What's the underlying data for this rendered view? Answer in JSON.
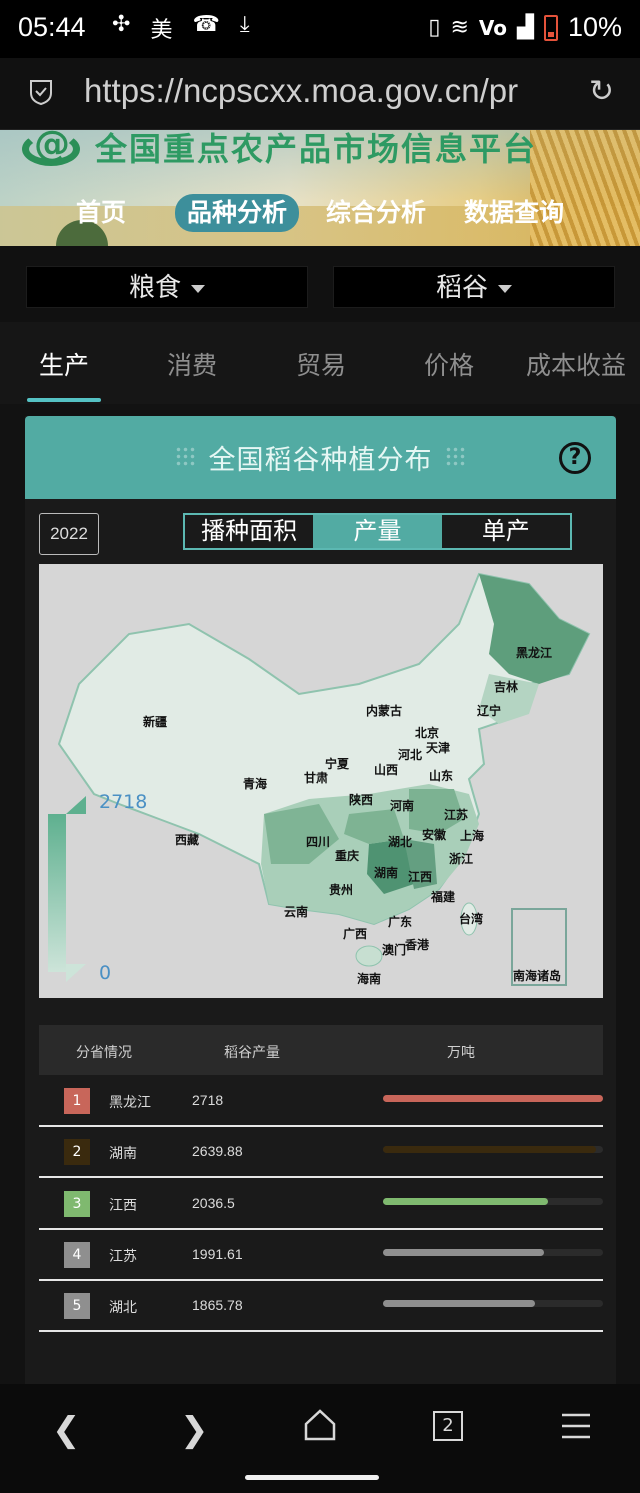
{
  "status_bar": {
    "time": "05:44",
    "left_icons": [
      "fan-icon",
      "meituan-icon",
      "phone-hangup-icon",
      "download-icon"
    ],
    "left_glyph_mei": "美",
    "right_icons": [
      "vibrate-icon",
      "wifi-icon",
      "volte-icon",
      "signal-icon",
      "battery-icon"
    ],
    "battery_text": "10%",
    "volte_text": "Vo"
  },
  "browser": {
    "url": "https://ncpscxx.moa.gov.cn/pr",
    "reload_icon": "reload-icon"
  },
  "banner": {
    "site_title": "全国重点农产品市场信息平台",
    "nav": [
      "首页",
      "品种分析",
      "综合分析",
      "数据查询"
    ],
    "active_nav_index": 1
  },
  "selects": {
    "category": "粮食",
    "variety": "稻谷"
  },
  "tabs": {
    "items": [
      "生产",
      "消费",
      "贸易",
      "价格",
      "成本收益"
    ],
    "active_index": 0
  },
  "card": {
    "title": "全国稻谷种植分布",
    "help_icon": "?",
    "year": "2022",
    "segments": [
      "播种面积",
      "产量",
      "单产"
    ],
    "active_segment": 1
  },
  "map": {
    "legend_max": "2718",
    "legend_min": "0",
    "labels": {
      "heilongjiang": "黑龙江",
      "jilin": "吉林",
      "liaoning": "辽宁",
      "neimenggu": "内蒙古",
      "beijing": "北京",
      "tianjin": "天津",
      "hebei": "河北",
      "shanxi": "山西",
      "shandong": "山东",
      "xinjiang": "新疆",
      "qinghai": "青海",
      "gansu": "甘肃",
      "ningxia": "宁夏",
      "shaanxi": "陕西",
      "henan": "河南",
      "jiangsu": "江苏",
      "anhui": "安徽",
      "shanghai": "上海",
      "xizang": "西藏",
      "sichuan": "四川",
      "chongqing": "重庆",
      "hubei": "湖北",
      "zhejiang": "浙江",
      "hunan": "湖南",
      "jiangxi": "江西",
      "guizhou": "贵州",
      "fujian": "福建",
      "yunnan": "云南",
      "guangxi": "广西",
      "guangdong": "广东",
      "taiwan": "台湾",
      "hongkong": "香港",
      "macau": "澳门",
      "hainan": "海南",
      "nanhai": "南海诸岛"
    }
  },
  "table": {
    "headers": [
      "分省情况",
      "稻谷产量",
      "万吨"
    ],
    "rows": [
      {
        "rank": "1",
        "name": "黑龙江",
        "value": "2718",
        "fraction": 1.0,
        "rank_color": "#c8665a",
        "bar_color": "#c8665a"
      },
      {
        "rank": "2",
        "name": "湖南",
        "value": "2639.88",
        "fraction": 0.97,
        "rank_color": "#3a2a0e",
        "bar_color": "#3a2a0e"
      },
      {
        "rank": "3",
        "name": "江西",
        "value": "2036.5",
        "fraction": 0.75,
        "rank_color": "#7fb96f",
        "bar_color": "#7fb96f"
      },
      {
        "rank": "4",
        "name": "江苏",
        "value": "1991.61",
        "fraction": 0.73,
        "rank_color": "#8f8f8f",
        "bar_color": "#8f8f8f"
      },
      {
        "rank": "5",
        "name": "湖北",
        "value": "1865.78",
        "fraction": 0.69,
        "rank_color": "#8f8f8f",
        "bar_color": "#8f8f8f"
      }
    ]
  },
  "bottom_nav": {
    "icons": [
      "back-icon",
      "forward-icon",
      "home-icon",
      "tabs-icon",
      "menu-icon"
    ],
    "tab_count": "2"
  }
}
